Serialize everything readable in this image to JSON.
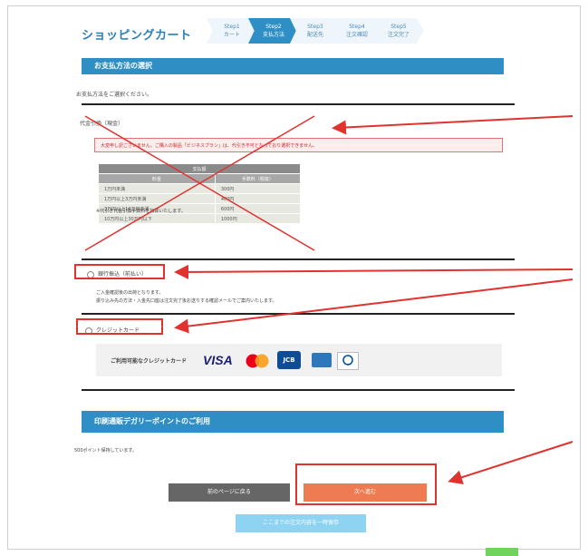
{
  "header": {
    "title": "ショッピングカート",
    "steps": [
      {
        "top": "Step1",
        "bottom": "カート"
      },
      {
        "top": "Step2",
        "bottom": "支払方法"
      },
      {
        "top": "Step3",
        "bottom": "配送先"
      },
      {
        "top": "Step4",
        "bottom": "注文確認"
      },
      {
        "top": "Step5",
        "bottom": "注文完了"
      }
    ]
  },
  "payment": {
    "section_title": "お支払方法の選択",
    "instruction": "お支払方法をご選択ください。",
    "cod": {
      "label": "代金引換（現金）",
      "warning": "大変申し訳ございません。ご購入の製品「ビジネスプラン」は、代引き不可となっており選択できません。",
      "table_title": "支払額",
      "col_amount": "料金",
      "col_fee": "手数料（税抜）",
      "rows": [
        {
          "amount": "1万円未満",
          "fee": "300円"
        },
        {
          "amount": "1万円以上3万円未満",
          "fee": "400円"
        },
        {
          "amount": "3万円以上10万円未満",
          "fee": "600円"
        },
        {
          "amount": "10万円以上30万円以下",
          "fee": "1000円"
        }
      ],
      "note": "※代引き代金引換手数料を加算いたします。"
    },
    "bank": {
      "label": "銀行振込（前払い）",
      "note1": "ご入金確認後の出荷となります。",
      "note2": "振り込み先の方法・入金先口座は注文完了後お送りする確認メールでご案内いたします。"
    },
    "credit": {
      "label": "クレジットカード",
      "cards_label": "ご利用可能なクレジットカード",
      "visa": "VISA",
      "jcb": "JCB"
    }
  },
  "points": {
    "section_title": "印刷通販デガリーポイントのご利用",
    "balance": "500ポイント保持しています。"
  },
  "buttons": {
    "back": "前のページに戻る",
    "next": "次へ進む",
    "save": "ここまでの注文内容を一時保存"
  },
  "colors": {
    "accent": "#2f8fc5",
    "next_button": "#ef7b52",
    "back_button": "#666666",
    "annotation_red": "#e0322f"
  }
}
